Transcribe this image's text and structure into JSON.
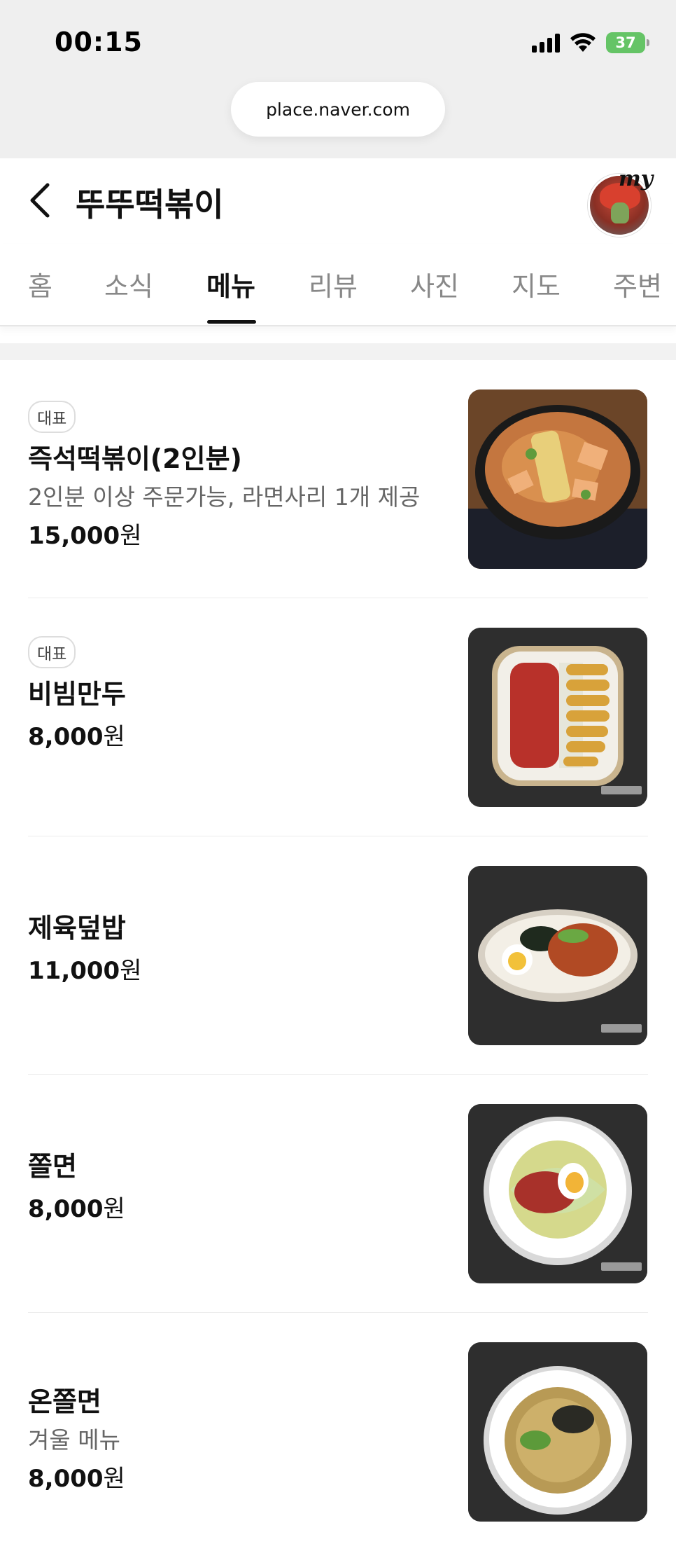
{
  "status_bar": {
    "time": "00:15",
    "battery": "37"
  },
  "browser": {
    "url": "place.naver.com"
  },
  "header": {
    "title": "뚜뚜떡볶이",
    "my_label": "my"
  },
  "tabs": [
    {
      "label": "홈",
      "active": false
    },
    {
      "label": "소식",
      "active": false
    },
    {
      "label": "메뉴",
      "active": true
    },
    {
      "label": "리뷰",
      "active": false
    },
    {
      "label": "사진",
      "active": false
    },
    {
      "label": "지도",
      "active": false
    },
    {
      "label": "주변",
      "active": false
    }
  ],
  "menu": [
    {
      "badge": "대표",
      "name": "즉석떡볶이(2인분)",
      "description": "2인분 이상 주문가능, 라면사리 1개 제공",
      "price": "15,000",
      "currency": "원",
      "image": "tteokbokki-photo"
    },
    {
      "badge": "대표",
      "name": "비빔만두",
      "description": "",
      "price": "8,000",
      "currency": "원",
      "image": "bibim-mandu-photo"
    },
    {
      "badge": "",
      "name": "제육덮밥",
      "description": "",
      "price": "11,000",
      "currency": "원",
      "image": "jeyuk-rice-photo"
    },
    {
      "badge": "",
      "name": "쫄면",
      "description": "",
      "price": "8,000",
      "currency": "원",
      "image": "jjolmyeon-photo"
    },
    {
      "badge": "",
      "name": "온쫄면",
      "description": "겨울 메뉴",
      "price": "8,000",
      "currency": "원",
      "image": "on-jjolmyeon-photo"
    }
  ]
}
